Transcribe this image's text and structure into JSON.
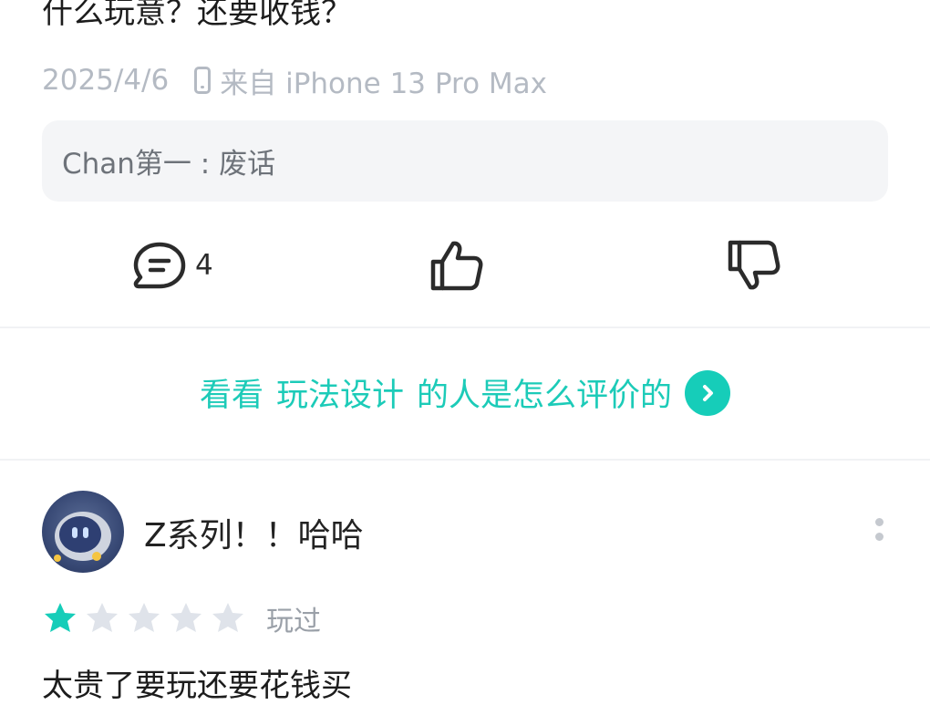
{
  "review_prev": {
    "text": "什么玩意？还要收钱？",
    "date": "2025/4/6",
    "device": "来自 iPhone 13 Pro Max",
    "reply": "Chan第一 : 废话",
    "comment_count": "4"
  },
  "see_more": {
    "prefix": "看看",
    "tag": "玩法设计",
    "suffix": "的人是怎么评价的"
  },
  "review_next": {
    "username": "Z系列！！哈哈",
    "rating": 1,
    "max_rating": 5,
    "status": "玩过",
    "text": "太贵了要玩还要花钱买"
  },
  "colors": {
    "accent": "#16cdb9",
    "star_off": "#dfe3ea",
    "meta": "#b4bac3"
  }
}
